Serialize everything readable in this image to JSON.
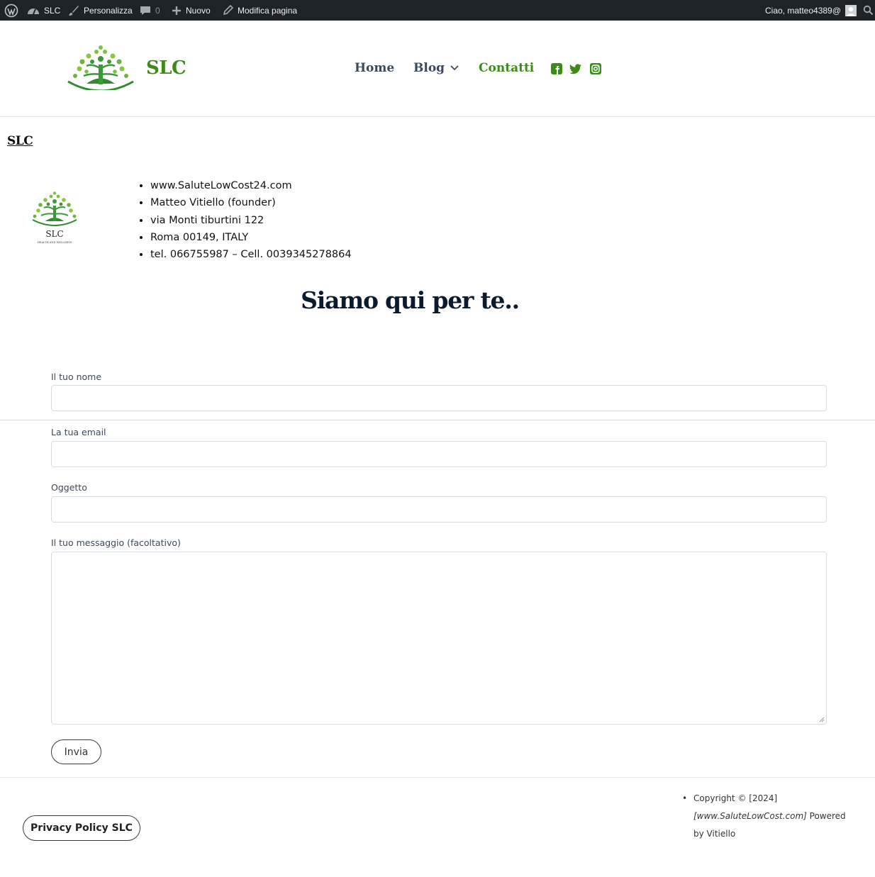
{
  "adminbar": {
    "site": "SLC",
    "customize": "Personalizza",
    "comments": "0",
    "new": "Nuovo",
    "edit": "Modifica pagina",
    "greeting": "Ciao, matteo4389@"
  },
  "header": {
    "brand": "SLC",
    "nav": [
      {
        "label": "Home"
      },
      {
        "label": "Blog"
      },
      {
        "label": "Contatti"
      }
    ],
    "social": [
      "facebook-icon",
      "twitter-icon",
      "instagram-icon"
    ],
    "colors": {
      "accent": "#3c8a1a",
      "nav": "#3a4a5c"
    }
  },
  "page": {
    "site_title": "SLC",
    "logo_text": "SLC",
    "logo_tagline": "HEALTH AND WELLNESS",
    "info": [
      "www.SaluteLowCost24.com",
      "Matteo Vitiello (founder)",
      "via Monti tiburtini 122",
      "Roma 00149, ITALY",
      "tel. 066755987 – Cell. 0039345278864"
    ],
    "heading": "Siamo qui per te.."
  },
  "form": {
    "name_label": "Il tuo nome",
    "email_label": "La tua email",
    "subject_label": "Oggetto",
    "message_label": "Il tuo messaggio (facoltativo)",
    "submit": "Invia"
  },
  "footer": {
    "privacy": "Privacy Policy SLC",
    "copyright_prefix": "Copyright © [2024]",
    "copyright_site": "[www.SaluteLowCost.com]",
    "copyright_suffix": "Powered by Vitiello"
  }
}
